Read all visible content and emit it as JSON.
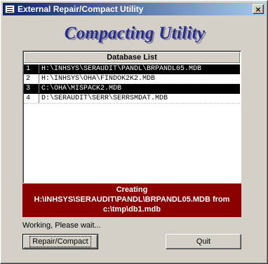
{
  "window": {
    "title": "External Repair/Compact Utility",
    "close_glyph": "×"
  },
  "heading": "Compacting Utility",
  "database_list": {
    "header": "Database List",
    "rows": [
      {
        "num": "1",
        "path": "H:\\INHSYS\\SERAUDIT\\PANDL\\BRPANDL05.MDB",
        "selected": true
      },
      {
        "num": "2",
        "path": "H:\\INHSYS\\OHA\\FINDOK2K2.MDB",
        "selected": false
      },
      {
        "num": "3",
        "path": "C:\\OHA\\MISPACK2.MDB",
        "selected": true
      },
      {
        "num": "4",
        "path": "D:\\SERAUDIT\\SERR\\SERRSMDAT.MDB",
        "selected": false
      }
    ]
  },
  "status": {
    "line1": "Creating",
    "line2": "H:\\INHSYS\\SERAUDIT\\PANDL\\BRPANDL05.MDB from",
    "line3": "c:\\tmp\\db1.mdb"
  },
  "working_text": "Working, Please wait...",
  "buttons": {
    "repair_compact": "Repair/Compact",
    "quit": "Quit"
  },
  "colors": {
    "status_bg": "#8b0000",
    "heading": "#2a2e8a",
    "selection": "#000000"
  }
}
